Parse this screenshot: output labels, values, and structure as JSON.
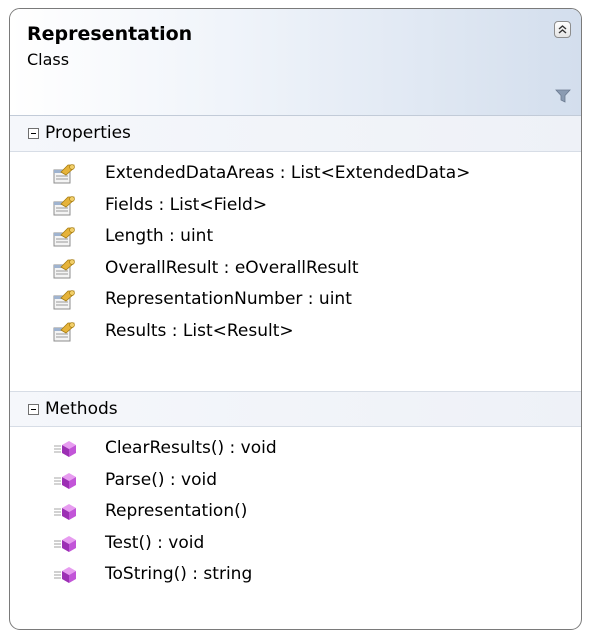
{
  "class": {
    "name": "Representation",
    "kind": "Class"
  },
  "sections": {
    "properties": {
      "title": "Properties",
      "items": [
        "ExtendedDataAreas : List<ExtendedData>",
        "Fields : List<Field>",
        "Length : uint",
        "OverallResult : eOverallResult",
        "RepresentationNumber : uint",
        "Results : List<Result>"
      ],
      "icon": "property-icon"
    },
    "methods": {
      "title": "Methods",
      "items": [
        "ClearResults() : void",
        "Parse() : void",
        "Representation()",
        "Test() : void",
        "ToString() : string"
      ],
      "icon": "method-icon"
    }
  },
  "icons": {
    "collapse": "double-chevron-up-icon",
    "filter": "filter-icon",
    "expander": "minus-box-icon"
  },
  "colors": {
    "header_gradient_end": "#d3deed",
    "border": "#7a7a7a",
    "method_icon": "#b445c8",
    "property_icon": "#d9a520"
  }
}
